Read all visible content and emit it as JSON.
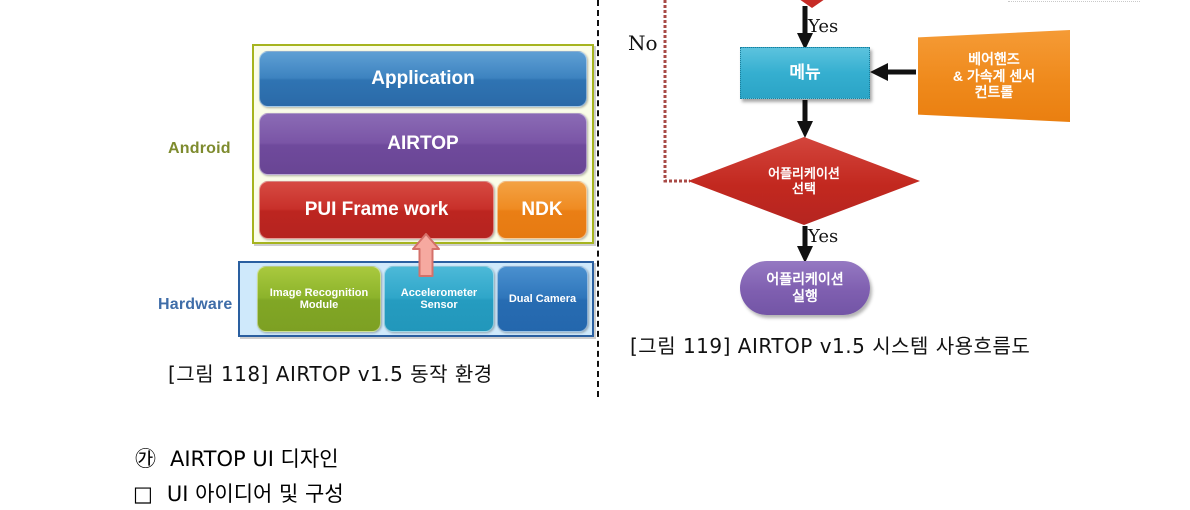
{
  "document": {
    "figures": [
      {
        "id": "figure-118",
        "caption": "[그림 118]  AIRTOP v1.5 동작 환경",
        "side_labels": {
          "android": "Android",
          "hardware": "Hardware"
        },
        "android_stack": [
          {
            "label": "Application",
            "color": "#2f74b3"
          },
          {
            "label": "AIRTOP",
            "color": "#6f4a9c"
          },
          {
            "label": "PUI Frame work",
            "color": "#bd2520"
          },
          {
            "label": "NDK",
            "color": "#ea7f15"
          }
        ],
        "hardware_stack": [
          {
            "label": "Image Recognition Module",
            "line1": "Image Recognition",
            "line2": "Module",
            "color": "#81a725"
          },
          {
            "label": "Accelerometer Sensor",
            "line1": "Accelerometer",
            "line2": "Sensor",
            "color": "#259cc0"
          },
          {
            "label": "Dual Camera",
            "line1": "Dual Camera",
            "line2": "",
            "color": "#276cb2"
          }
        ],
        "arrow": {
          "name": "up-arrow",
          "direction": "up",
          "color": "#f4a8a0"
        }
      },
      {
        "id": "figure-119",
        "caption": "[그림 119]  AIRTOP v1.5 시스템 사용흐름도",
        "nodes": [
          {
            "name": "decision-top-partial",
            "label": "",
            "shape": "diamond",
            "color": "#c62b26"
          },
          {
            "name": "menu",
            "label": "메뉴",
            "shape": "rect",
            "color": "#2ba4c6"
          },
          {
            "name": "barehands-control",
            "line1": "베어핸즈",
            "line2": "& 가속계 센서",
            "line3": "컨트롤",
            "label": "베어핸즈 & 가속계 센서 컨트롤",
            "shape": "parallelogram",
            "color": "#ea7f10"
          },
          {
            "name": "application-select",
            "line1": "어플리케이션",
            "line2": "선택",
            "label": "어플리케이션 선택",
            "shape": "diamond",
            "color": "#b52520"
          },
          {
            "name": "application-run",
            "line1": "어플리케이션",
            "line2": "실행",
            "label": "어플리케이션 실행",
            "shape": "rounded-rect",
            "color": "#7355a6"
          }
        ],
        "edge_labels": {
          "yes_top": "Yes",
          "yes_bottom": "Yes",
          "no": "No"
        }
      }
    ],
    "body_text": [
      {
        "marker": "㉮",
        "text": "AIRTOP UI 디자인"
      },
      {
        "marker": "□",
        "text": "UI 아이디어 및 구성"
      }
    ]
  }
}
